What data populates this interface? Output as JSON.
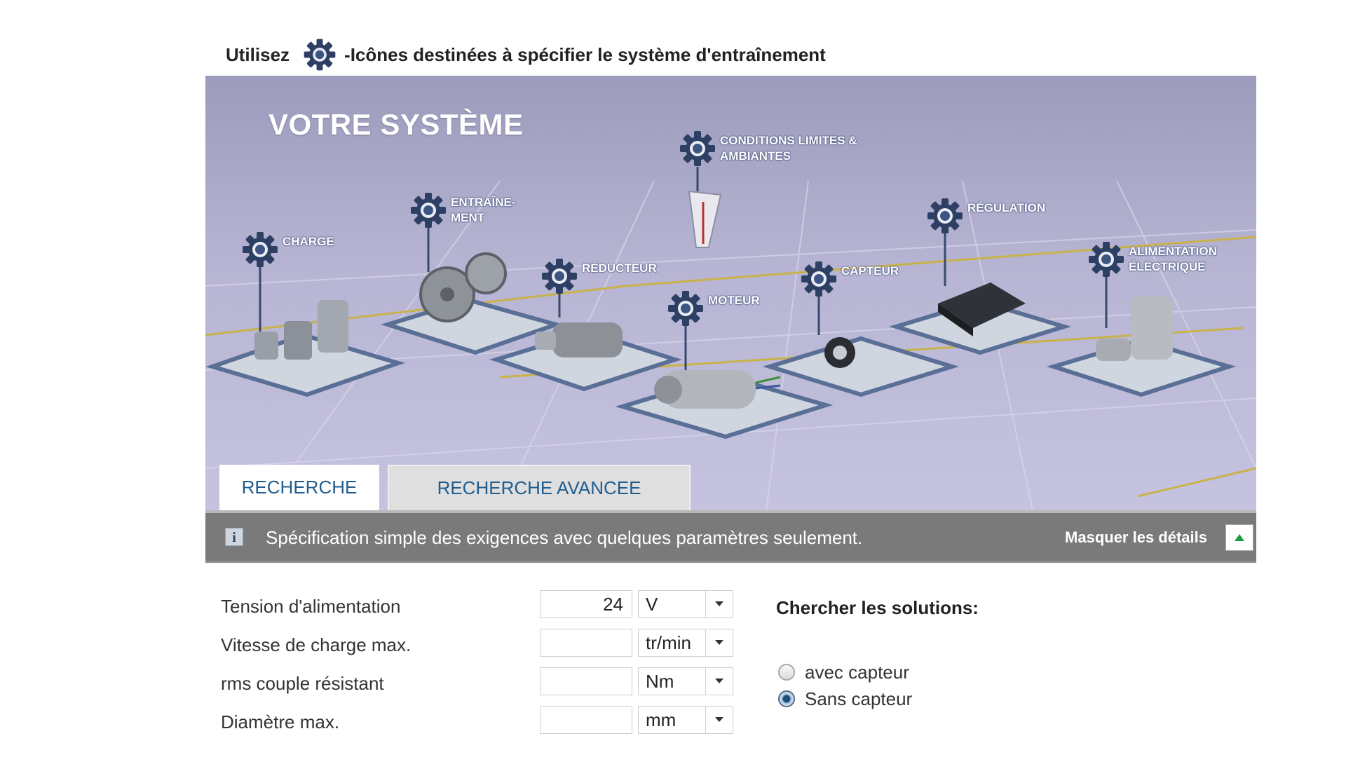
{
  "hint": {
    "prefix": "Utilisez",
    "suffix": "-Icônes destinées à spécifier le système d'entraînement"
  },
  "banner": {
    "title": "VOTRE SYSTÈME",
    "nodes": [
      {
        "id": "charge",
        "label": "CHARGE"
      },
      {
        "id": "entrainement",
        "label": "ENTRAÎNE-\nMENT"
      },
      {
        "id": "reducteur",
        "label": "RÉDUCTEUR"
      },
      {
        "id": "conditions",
        "label": "CONDITIONS LIMITES &\nAMBIANTES"
      },
      {
        "id": "moteur",
        "label": "MOTEUR"
      },
      {
        "id": "capteur",
        "label": "CAPTEUR"
      },
      {
        "id": "regulation",
        "label": "RÉGULATION"
      },
      {
        "id": "alimentation",
        "label": "ALIMENTATION\nÉLECTRIQUE"
      }
    ]
  },
  "tabs": [
    {
      "label": "RECHERCHE",
      "active": true
    },
    {
      "label": "RECHERCHE AVANCEE",
      "active": false
    }
  ],
  "infobar": {
    "icon": "info-icon",
    "text": "Spécification simple des exigences avec quelques paramètres seulement.",
    "hide_label": "Masquer les détails"
  },
  "form": {
    "fields": [
      {
        "label": "Tension d'alimentation",
        "value": "24",
        "unit": "V"
      },
      {
        "label": "Vitesse de charge max.",
        "value": "",
        "unit": "tr/min"
      },
      {
        "label": "rms couple résistant",
        "value": "",
        "unit": "Nm"
      },
      {
        "label": "Diamètre max.",
        "value": "",
        "unit": "mm"
      }
    ]
  },
  "search": {
    "title": "Chercher les solutions:",
    "options": [
      {
        "label": "avec capteur",
        "checked": false
      },
      {
        "label": "Sans capteur",
        "checked": true
      }
    ]
  },
  "colors": {
    "accent": "#1f5d8f",
    "infobar_bg": "#7a7a7a",
    "banner_bg": "#b7b5d3"
  }
}
